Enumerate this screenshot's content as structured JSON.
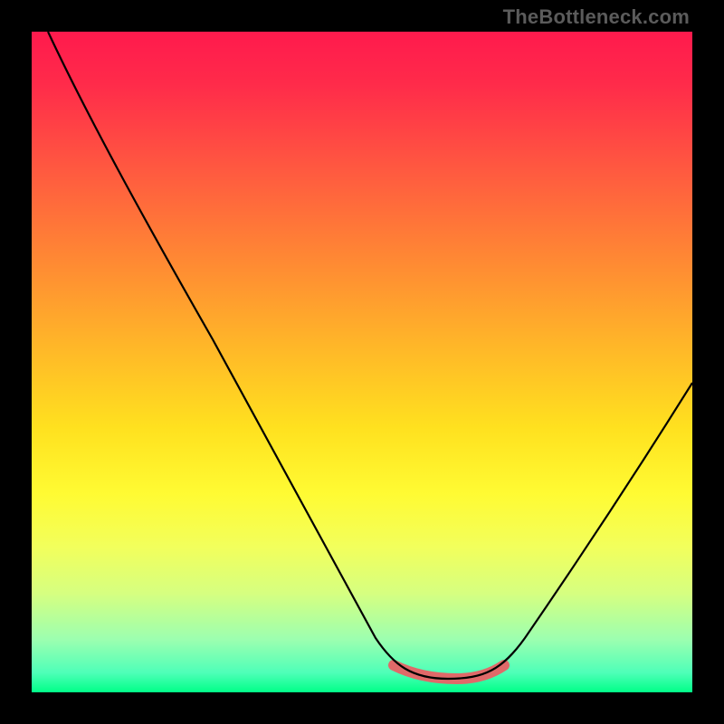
{
  "watermark": "TheBottleneck.com",
  "chart_data": {
    "type": "line",
    "title": "",
    "xlabel": "",
    "ylabel": "",
    "xlim": [
      0,
      100
    ],
    "ylim": [
      0,
      100
    ],
    "grid": false,
    "legend": false,
    "series": [
      {
        "name": "bottleneck-curve",
        "color": "#000000",
        "x": [
          0,
          5,
          10,
          15,
          20,
          25,
          30,
          35,
          40,
          45,
          50,
          55,
          60,
          62,
          65,
          70,
          75,
          80,
          85,
          90,
          95,
          100
        ],
        "y": [
          100,
          94,
          87,
          80,
          72,
          64,
          56,
          47,
          38,
          29,
          20,
          12,
          5,
          3,
          3,
          3,
          5,
          10,
          18,
          28,
          40,
          55
        ]
      }
    ],
    "optimal_zone": {
      "name": "highlight-range",
      "color": "#e06969",
      "x_start": 55,
      "x_end": 72,
      "y": 3
    }
  }
}
